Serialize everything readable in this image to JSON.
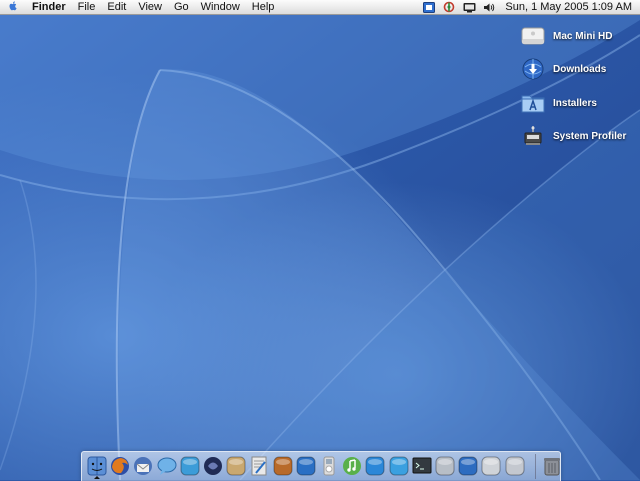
{
  "menubar": {
    "apple_icon": "apple-logo-icon",
    "app_name": "Finder",
    "menus": [
      "File",
      "Edit",
      "View",
      "Go",
      "Window",
      "Help"
    ],
    "status_icons": [
      "display-icon",
      "network-icon",
      "battery-icon",
      "volume-icon"
    ],
    "clock": "Sun, 1 May 2005  1:09 AM"
  },
  "desktop": {
    "icons": [
      {
        "label": "Mac Mini HD",
        "icon": "hard-drive-icon"
      },
      {
        "label": "Downloads",
        "icon": "downloads-folder-icon"
      },
      {
        "label": "Installers",
        "icon": "installers-folder-icon"
      },
      {
        "label": "System Profiler",
        "icon": "system-profiler-icon"
      }
    ]
  },
  "dock": {
    "running_app": "Finder",
    "items": [
      {
        "name": "finder",
        "color": "#5b8fd6"
      },
      {
        "name": "firefox",
        "color": "#e07a1f"
      },
      {
        "name": "thunderbird",
        "color": "#4a72b8"
      },
      {
        "name": "ichat",
        "color": "#6fb2e8"
      },
      {
        "name": "network",
        "color": "#3c9cd8"
      },
      {
        "name": "shadow",
        "color": "#1f2b55"
      },
      {
        "name": "package",
        "color": "#c9a870"
      },
      {
        "name": "textedit",
        "color": "#e9e9e9"
      },
      {
        "name": "photos",
        "color": "#b86a2a"
      },
      {
        "name": "dictionary",
        "color": "#2a6fc4"
      },
      {
        "name": "ipod",
        "color": "#dcdcdc"
      },
      {
        "name": "itunes",
        "color": "#59b04a"
      },
      {
        "name": "quicktime",
        "color": "#2b87d8"
      },
      {
        "name": "media-player",
        "color": "#3aa0e0"
      },
      {
        "name": "terminal",
        "color": "#333a40"
      },
      {
        "name": "disk-utility",
        "color": "#b8bec6"
      },
      {
        "name": "itunes-blue",
        "color": "#2d6cc0"
      },
      {
        "name": "drive",
        "color": "#cfd3d8"
      },
      {
        "name": "preferences",
        "color": "#c4c8cf"
      },
      {
        "name": "trash",
        "color": "#8c9098"
      }
    ]
  }
}
